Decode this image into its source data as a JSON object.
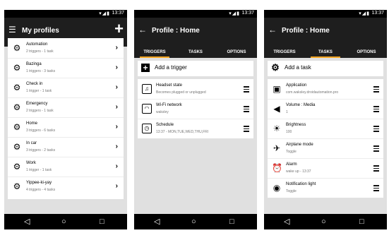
{
  "status": {
    "time": "13:37",
    "icons": "▾◢▮"
  },
  "screen1": {
    "title": "My profiles",
    "profiles": [
      {
        "name": "Automation",
        "summary": "2 triggers - 1 task",
        "icon": "profile-icon"
      },
      {
        "name": "Bazinga",
        "summary": "1 triggers - 3 tasks",
        "icon": "profile-icon"
      },
      {
        "name": "Check in",
        "summary": "1 trigger - 1 task",
        "icon": "profile-icon"
      },
      {
        "name": "Emergency",
        "summary": "2 triggers - 1 task",
        "icon": "profile-icon"
      },
      {
        "name": "Home",
        "summary": "3 triggers - 6 tasks",
        "icon": "profile-icon"
      },
      {
        "name": "In car",
        "summary": "3 triggers - 2 tasks",
        "icon": "profile-icon"
      },
      {
        "name": "Work",
        "summary": "1 trigger - 1 task",
        "icon": "profile-icon"
      },
      {
        "name": "Yippee-ki-yay",
        "summary": "4 triggers - 4 tasks",
        "icon": "profile-icon"
      }
    ]
  },
  "screen2": {
    "title": "Profile : Home",
    "tabs": [
      "TRIGGERS",
      "TASKS",
      "OPTIONS"
    ],
    "add_label": "Add a trigger",
    "items": [
      {
        "name": "Headset state",
        "detail": "Becomes plugged or unplugged",
        "icon": "headset-icon"
      },
      {
        "name": "Wi-Fi network",
        "detail": "waksley",
        "icon": "wifi-icon"
      },
      {
        "name": "Schedule",
        "detail": "13:37 - MON,TUE,WED,THU,FRI",
        "icon": "clock-icon"
      }
    ]
  },
  "screen3": {
    "title": "Profile : Home",
    "tabs": [
      "TRIGGERS",
      "TASKS",
      "OPTIONS"
    ],
    "add_label": "Add a task",
    "items": [
      {
        "name": "Application",
        "detail": "com.waksley.droidautomation.pro",
        "icon": "app-box-icon"
      },
      {
        "name": "Volume : Media",
        "detail": "1",
        "icon": "volume-icon"
      },
      {
        "name": "Brightness",
        "detail": "100",
        "icon": "brightness-icon"
      },
      {
        "name": "Airplane mode",
        "detail": "Toggle",
        "icon": "airplane-icon"
      },
      {
        "name": "Alarm",
        "detail": "wake up - 13:37",
        "icon": "alarm-icon"
      },
      {
        "name": "Notification light",
        "detail": "Toggle",
        "icon": "notification-light-icon"
      }
    ]
  },
  "colors": {
    "toolbar": "#1e1e1e",
    "accent": "#f5a623",
    "background": "#e0e0e0"
  }
}
